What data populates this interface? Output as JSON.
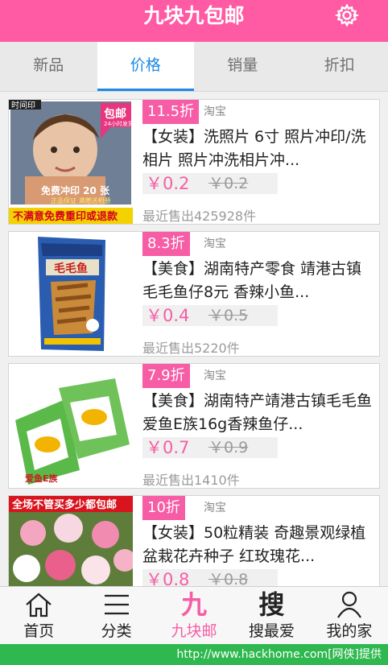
{
  "header": {
    "title": "九块九包邮",
    "settings_icon": "gear-icon"
  },
  "tabs": [
    {
      "label": "新品",
      "active": false
    },
    {
      "label": "价格",
      "active": true
    },
    {
      "label": "销量",
      "active": false
    },
    {
      "label": "折扣",
      "active": false
    }
  ],
  "products": [
    {
      "discount": "11.5折",
      "source": "淘宝",
      "title": "【女装】洗照片 6寸 照片冲印/洗相片 照片冲洗相片冲...",
      "price": "￥0.2",
      "original_price": "￥0.2",
      "sold": "最近售出425928件",
      "image": {
        "label_top": "包邮",
        "label_hours": "24小时发货",
        "line_free": "免费冲印 20 张",
        "line_sub": "正品保证 满赠送相册",
        "line_bottom": "不满意免费重印或退款",
        "brand": "时间印"
      }
    },
    {
      "discount": "8.3折",
      "source": "淘宝",
      "title": "【美食】湖南特产零食 靖港古镇毛毛鱼仔8元 香辣小鱼...",
      "price": "￥0.4",
      "original_price": "￥0.5",
      "sold": "最近售出5220件",
      "image": {
        "brand": "毛毛鱼"
      }
    },
    {
      "discount": "7.9折",
      "source": "淘宝",
      "title": "【美食】湖南特产靖港古镇毛毛鱼 爱鱼E族16g香辣鱼仔...",
      "price": "￥0.7",
      "original_price": "￥0.9",
      "sold": "最近售出1410件",
      "image": {
        "brand": "爱鱼E族"
      }
    },
    {
      "discount": "10折",
      "source": "淘宝",
      "title": "【女装】50粒精装 奇趣景观绿植盆栽花卉种子 红玫瑰花...",
      "price": "￥0.8",
      "original_price": "￥0.8",
      "sold": "",
      "image": {
        "banner": "全场不管买多少都包邮"
      }
    }
  ],
  "bottom_nav": [
    {
      "label": "首页",
      "icon": "home-icon",
      "active": false
    },
    {
      "label": "分类",
      "icon": "menu-lines-icon",
      "active": false
    },
    {
      "label": "九块邮",
      "icon": "jiu-glyph-icon",
      "glyph": "九",
      "active": true
    },
    {
      "label": "搜最爱",
      "icon": "search-glyph-icon",
      "glyph": "搜",
      "active": false
    },
    {
      "label": "我的家",
      "icon": "person-icon",
      "active": false
    }
  ],
  "footer": {
    "text": "http://www.hackhome.com[网侠]提供"
  },
  "colors": {
    "brand_pink": "#ff5aa4",
    "tab_active_blue": "#1e88e5",
    "footer_green": "#2fb84f"
  }
}
